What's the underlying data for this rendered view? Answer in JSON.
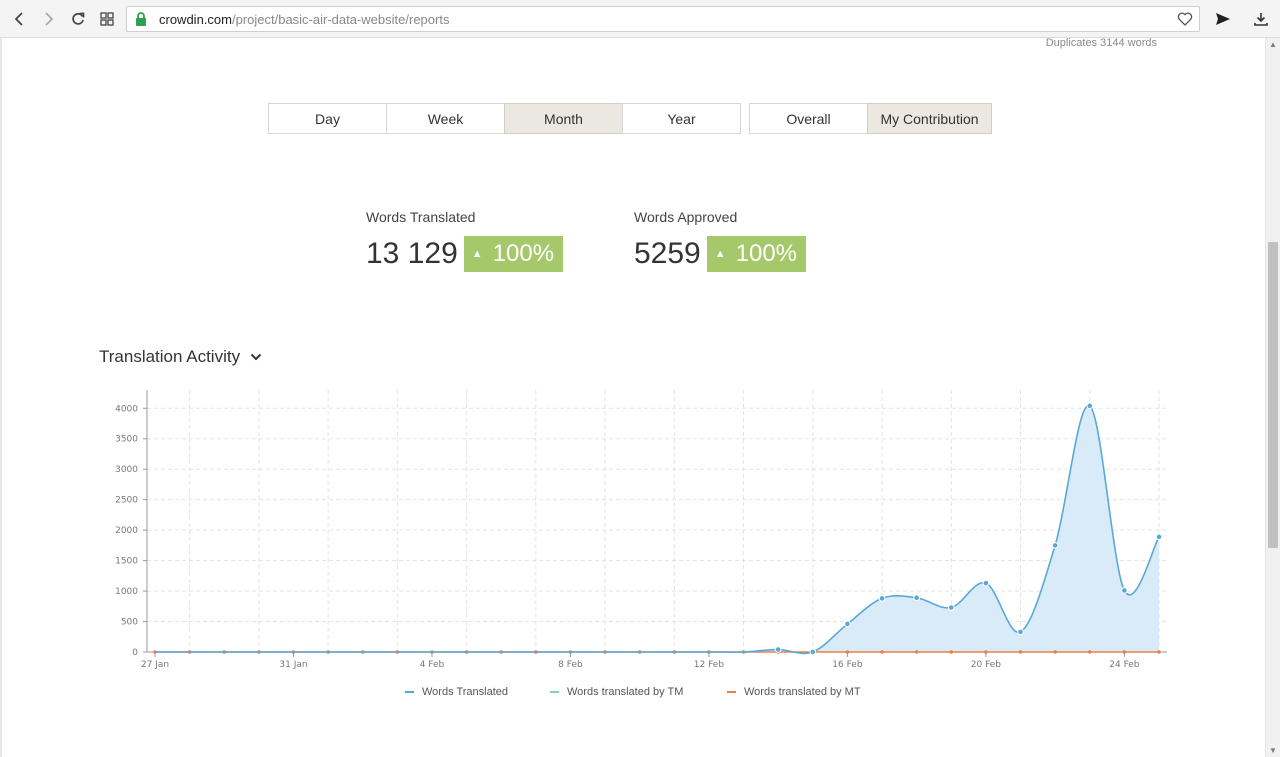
{
  "browser": {
    "url_domain": "crowdin.com",
    "url_path": "/project/basic-air-data-website/reports"
  },
  "duplicates_text": "Duplicates 3144 words",
  "period_tabs": [
    {
      "label": "Day",
      "active": false
    },
    {
      "label": "Week",
      "active": false
    },
    {
      "label": "Month",
      "active": true
    },
    {
      "label": "Year",
      "active": false
    }
  ],
  "scope_tabs": [
    {
      "label": "Overall",
      "active": false
    },
    {
      "label": "My Contribution",
      "active": true
    }
  ],
  "stats": {
    "translated": {
      "label": "Words Translated",
      "value": "13 129",
      "change": "100%"
    },
    "approved": {
      "label": "Words Approved",
      "value": "5259",
      "change": "100%"
    }
  },
  "section_title": "Translation Activity",
  "colors": {
    "accent_green": "#a5c86b",
    "series_translated": "#5aa8d8",
    "series_tm": "#8fd0a2",
    "series_mt": "#e8824a"
  },
  "chart_data": {
    "type": "area",
    "y_ticks": [
      0,
      500,
      1000,
      1500,
      2000,
      2500,
      3000,
      3500,
      4000
    ],
    "ylim": [
      0,
      4300
    ],
    "x_tick_labels": [
      {
        "day": 0,
        "label": "27 Jan"
      },
      {
        "day": 4,
        "label": "31 Jan"
      },
      {
        "day": 8,
        "label": "4 Feb"
      },
      {
        "day": 12,
        "label": "8 Feb"
      },
      {
        "day": 16,
        "label": "12 Feb"
      },
      {
        "day": 20,
        "label": "16 Feb"
      },
      {
        "day": 24,
        "label": "20 Feb"
      },
      {
        "day": 28,
        "label": "24 Feb"
      }
    ],
    "x": [
      "27 Jan",
      "28 Jan",
      "29 Jan",
      "30 Jan",
      "31 Jan",
      "1 Feb",
      "2 Feb",
      "3 Feb",
      "4 Feb",
      "5 Feb",
      "6 Feb",
      "7 Feb",
      "8 Feb",
      "9 Feb",
      "10 Feb",
      "11 Feb",
      "12 Feb",
      "13 Feb",
      "14 Feb",
      "15 Feb",
      "16 Feb",
      "17 Feb",
      "18 Feb",
      "19 Feb",
      "20 Feb",
      "21 Feb",
      "22 Feb",
      "23 Feb",
      "24 Feb",
      "25 Feb"
    ],
    "series": [
      {
        "name": "Words Translated",
        "values": [
          0,
          0,
          0,
          0,
          0,
          0,
          0,
          0,
          0,
          0,
          0,
          0,
          0,
          0,
          0,
          0,
          0,
          0,
          40,
          0,
          460,
          880,
          890,
          730,
          1130,
          330,
          1750,
          4040,
          1010,
          1890
        ]
      },
      {
        "name": "Words translated by TM",
        "values": [
          0,
          0,
          0,
          0,
          0,
          0,
          0,
          0,
          0,
          0,
          0,
          0,
          0,
          0,
          0,
          0,
          0,
          0,
          0,
          0,
          0,
          0,
          0,
          0,
          0,
          0,
          0,
          0,
          0,
          0
        ]
      },
      {
        "name": "Words translated by MT",
        "values": [
          0,
          0,
          0,
          0,
          0,
          0,
          0,
          0,
          0,
          0,
          0,
          0,
          0,
          0,
          0,
          0,
          0,
          0,
          0,
          0,
          0,
          0,
          0,
          0,
          0,
          0,
          0,
          0,
          0,
          0
        ]
      }
    ],
    "grid": true,
    "legend_position": "bottom"
  }
}
